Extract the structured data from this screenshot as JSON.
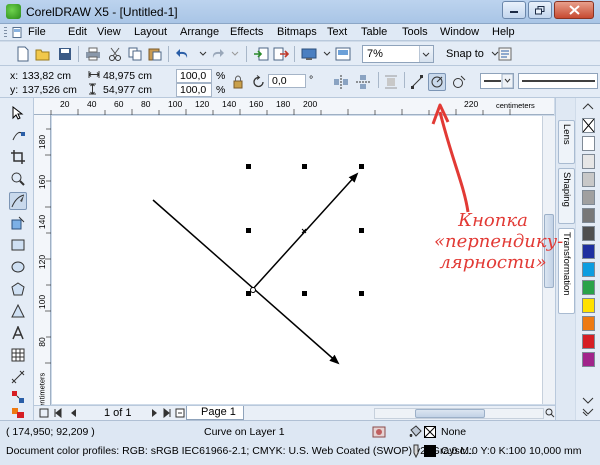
{
  "window": {
    "title": "CorelDRAW X5 - [Untitled-1]"
  },
  "menu": {
    "items": [
      "File",
      "Edit",
      "View",
      "Layout",
      "Arrange",
      "Effects",
      "Bitmaps",
      "Text",
      "Table",
      "Tools",
      "Window",
      "Help"
    ]
  },
  "toolbar": {
    "zoom_value": "7%",
    "snap_label": "Snap to"
  },
  "property_bar": {
    "x_label": "x:",
    "x_value": "133,82 cm",
    "y_label": "y:",
    "y_value": "137,526 cm",
    "width_value": "48,975 cm",
    "height_value": "54,977 cm",
    "scale_x": "100,0",
    "scale_y": "100,0",
    "pct": "%",
    "rotation": "0,0",
    "degree": "°"
  },
  "rulers": {
    "h_ticks": [
      "20",
      "40",
      "60",
      "80",
      "100",
      "120",
      "140",
      "160",
      "180",
      "200",
      "220"
    ],
    "h_unit": "centimeters",
    "v_ticks": [
      "180",
      "160",
      "140",
      "120",
      "100",
      "80"
    ],
    "v_unit": "centimeters"
  },
  "docker": {
    "tabs": [
      "Lens",
      "Shaping",
      "Transformation"
    ]
  },
  "palette": {
    "colors": [
      "#ffffff",
      "#e6e6e6",
      "#c8c8c8",
      "#a0a0a0",
      "#787878",
      "#505050",
      "#1e2fa0",
      "#0c9de0",
      "#2aa24a",
      "#ffe100",
      "#ee7a12",
      "#d61e24",
      "#a1248a"
    ]
  },
  "page_nav": {
    "page_count": "1 of 1",
    "page_tab": "Page 1"
  },
  "status": {
    "coords": "( 174,950; 92,209 )",
    "object_info": "Curve on Layer 1",
    "profiles": "Document color profiles: RGB: sRGB IEC61966-2.1; CMYK: U.S. Web Coated (SWOP) v2; Graysc...",
    "fill_label": "None",
    "outline_label": "C:0 M:0 Y:0 K:100  10,000 mm"
  },
  "annotation": {
    "line1": "Кнопка",
    "line2": "«перпендику-",
    "line3": "лярности»",
    "color": "#e23a35"
  }
}
